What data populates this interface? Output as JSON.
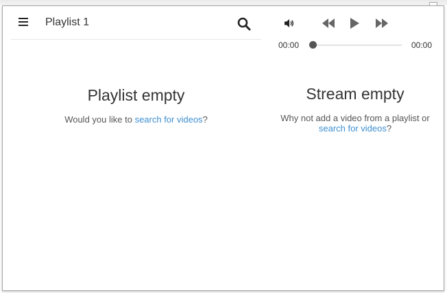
{
  "playlist": {
    "title": "Playlist 1",
    "empty_title": "Playlist empty",
    "empty_prefix": "Would you like to ",
    "empty_link": "search for videos",
    "empty_suffix": "?"
  },
  "player": {
    "time_current": "00:00",
    "time_total": "00:00",
    "progress": 0
  },
  "stream": {
    "empty_title": "Stream empty",
    "empty_prefix": "Why not add a video from a playlist or",
    "empty_link": "search for videos",
    "empty_suffix": "?"
  },
  "colors": {
    "link": "#3d8fd1",
    "seek_handle": "#555555",
    "text": "#333333"
  },
  "icons": {
    "menu": "hamburger-menu-icon",
    "search": "search-icon",
    "volume": "volume-icon",
    "rewind": "rewind-icon",
    "play": "play-icon",
    "forward": "fast-forward-icon"
  }
}
